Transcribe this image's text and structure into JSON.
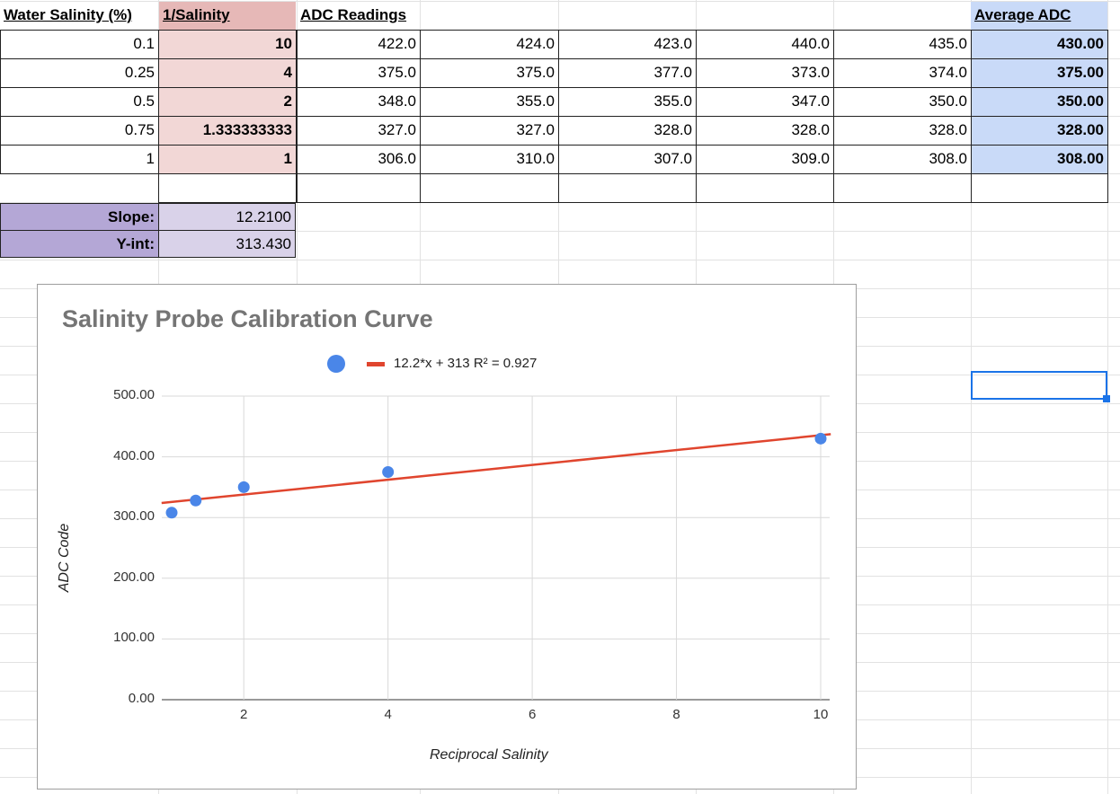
{
  "headers": {
    "salinity": "Water Salinity (%)",
    "inverse": "1/Salinity",
    "adc": "ADC Readings",
    "average": "Average ADC"
  },
  "rows": [
    {
      "salinity": "0.1",
      "inverse": "10",
      "readings": [
        "422.0",
        "424.0",
        "423.0",
        "440.0",
        "435.0"
      ],
      "average": "430.00"
    },
    {
      "salinity": "0.25",
      "inverse": "4",
      "readings": [
        "375.0",
        "375.0",
        "377.0",
        "373.0",
        "374.0"
      ],
      "average": "375.00"
    },
    {
      "salinity": "0.5",
      "inverse": "2",
      "readings": [
        "348.0",
        "355.0",
        "355.0",
        "347.0",
        "350.0"
      ],
      "average": "350.00"
    },
    {
      "salinity": "0.75",
      "inverse": "1.333333333",
      "readings": [
        "327.0",
        "327.0",
        "328.0",
        "328.0",
        "328.0"
      ],
      "average": "328.00"
    },
    {
      "salinity": "1",
      "inverse": "1",
      "readings": [
        "306.0",
        "310.0",
        "307.0",
        "309.0",
        "308.0"
      ],
      "average": "308.00"
    }
  ],
  "stats": {
    "slope_label": "Slope:",
    "slope_value": "12.2100",
    "yint_label": "Y-int:",
    "yint_value": "313.430"
  },
  "colors": {
    "inverse_header": "#e6b8b7",
    "inverse_cells": "#f2d7d6",
    "average_cells": "#c9daf8",
    "stat_labels": "#b4a7d6",
    "stat_values": "#d9d2e9",
    "points": "#4a86e8",
    "trendline": "#e0452e"
  },
  "chart_data": {
    "type": "scatter",
    "title": "Salinity Probe Calibration Curve",
    "xlabel": "Reciprocal Salinity",
    "ylabel": "ADC Code",
    "xlim": [
      1,
      10
    ],
    "ylim": [
      0,
      500
    ],
    "xticks": [
      "2",
      "4",
      "6",
      "8",
      "10"
    ],
    "yticks": [
      "0.00",
      "100.00",
      "200.00",
      "300.00",
      "400.00",
      "500.00"
    ],
    "grid": true,
    "legend_position": "top",
    "series": [
      {
        "x": [
          10,
          4,
          2,
          1.333333333,
          1
        ],
        "y": [
          430,
          375,
          350,
          328,
          308
        ]
      }
    ],
    "trendline": {
      "label": "12.2*x + 313 R² = 0.927",
      "slope": 12.21,
      "intercept": 313.43
    }
  }
}
